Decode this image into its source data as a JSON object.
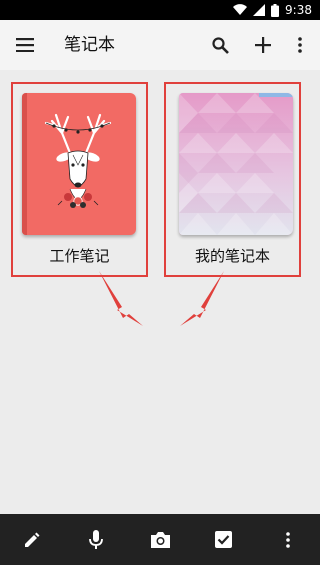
{
  "status_bar": {
    "time": "9:38",
    "icons": [
      "wifi-icon",
      "signal-icon",
      "battery-icon"
    ]
  },
  "toolbar": {
    "title": "笔记本",
    "icons": [
      "menu-icon",
      "search-icon",
      "add-icon",
      "more-vert-icon"
    ]
  },
  "notebooks": [
    {
      "name": "工作笔记",
      "cover": "deer-illustration-cover",
      "cover_color": "#f26a64"
    },
    {
      "name": "我的笔记本",
      "cover": "pastel-triangle-pattern-cover",
      "cover_color": "#e8b3d6"
    }
  ],
  "annotation": {
    "highlight_color": "#e0403c",
    "arrow_color": "#e0403c"
  },
  "bottom_bar": {
    "icons": [
      "pencil-icon",
      "microphone-icon",
      "camera-icon",
      "checkbox-icon",
      "more-vert-icon"
    ]
  }
}
